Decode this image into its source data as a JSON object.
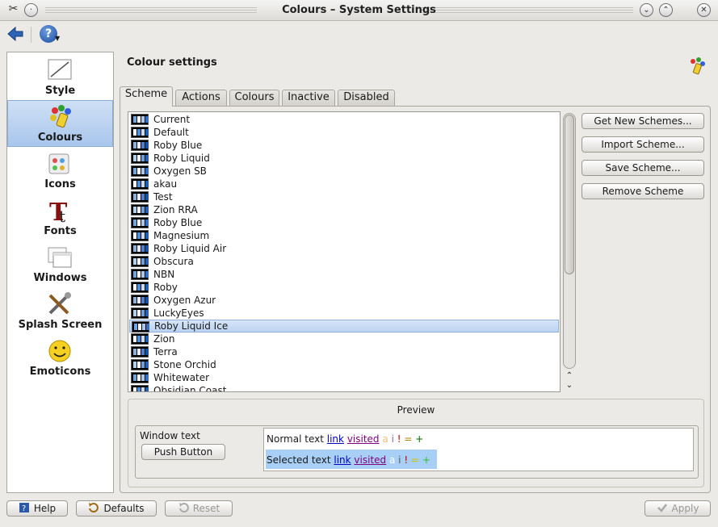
{
  "window": {
    "title": "Colours – System Settings"
  },
  "sidebar": {
    "items": [
      {
        "label": "Style",
        "icon": "style-icon"
      },
      {
        "label": "Colours",
        "icon": "colours-icon",
        "selected": true
      },
      {
        "label": "Icons",
        "icon": "icons-icon"
      },
      {
        "label": "Fonts",
        "icon": "fonts-icon"
      },
      {
        "label": "Windows",
        "icon": "windows-icon"
      },
      {
        "label": "Splash Screen",
        "icon": "splash-screen-icon"
      },
      {
        "label": "Emoticons",
        "icon": "emoticons-icon"
      }
    ]
  },
  "main": {
    "heading": "Colour settings",
    "tabs": [
      {
        "label": "Scheme",
        "selected": true
      },
      {
        "label": "Actions"
      },
      {
        "label": "Colours"
      },
      {
        "label": "Inactive"
      },
      {
        "label": "Disabled"
      }
    ],
    "schemes": [
      "Current",
      "Default",
      "Roby Blue",
      "Roby Liquid",
      "Oxygen SB",
      "akau",
      "Test",
      "Zion RRA",
      "Roby Blue",
      "Magnesium",
      "Roby Liquid Air",
      "Obscura",
      "NBN",
      "Roby",
      "Oxygen Azur",
      "LuckyEyes",
      "Roby Liquid Ice",
      "Zion",
      "Terra",
      "Stone Orchid",
      "Whitewater",
      "Obsidian Coast"
    ],
    "selected_scheme": "Roby Liquid Ice",
    "scheme_buttons": [
      "Get New Schemes...",
      "Import Scheme...",
      "Save Scheme...",
      "Remove Scheme"
    ],
    "preview": {
      "title": "Preview",
      "window_text": "Window text",
      "push_button": "Push Button",
      "normal_text": "Normal text",
      "selected_text": "Selected text",
      "link": "link",
      "visited": "visited",
      "symbols": [
        "a",
        "i",
        "!",
        "=",
        "+"
      ]
    }
  },
  "footer": {
    "help": "Help",
    "defaults": "Defaults",
    "reset": "Reset",
    "apply": "Apply"
  },
  "colors": {
    "selection": "#bcd3f1",
    "link": "#0000c0",
    "visited": "#800080",
    "selected_bg": "#a8cff5"
  }
}
